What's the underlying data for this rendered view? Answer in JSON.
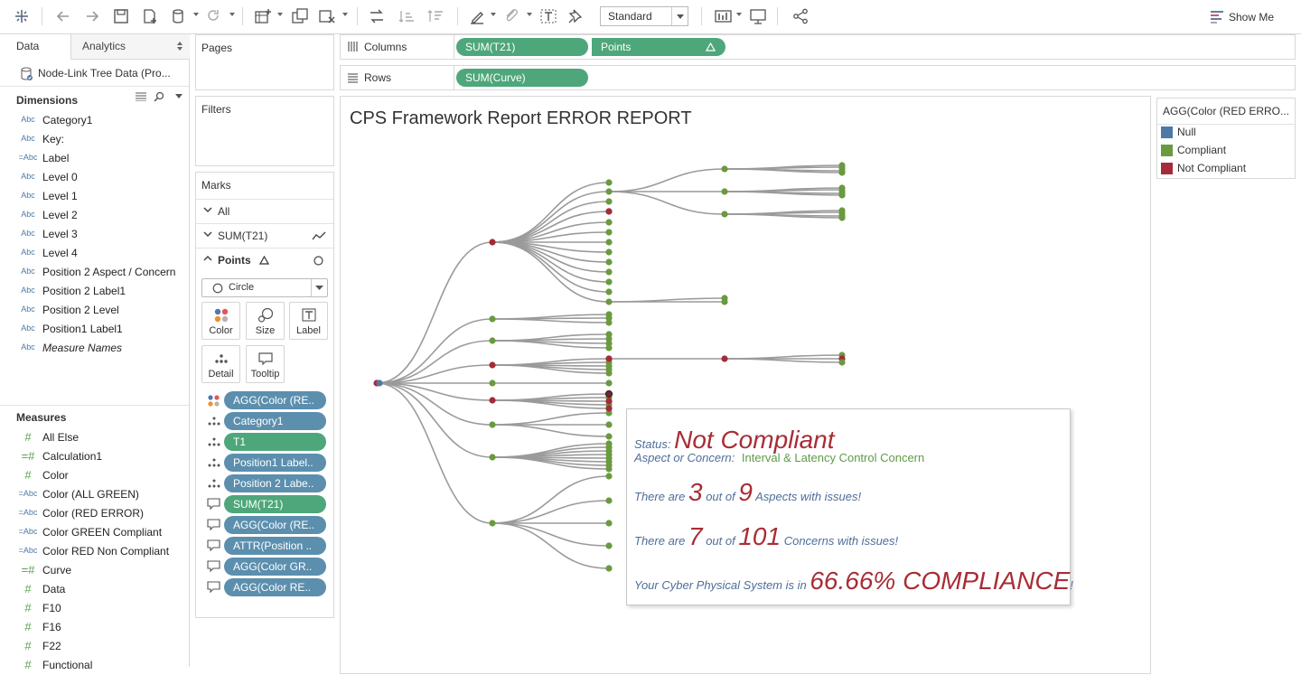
{
  "toolbar": {
    "fit_value": "Standard",
    "show_me_label": "Show Me"
  },
  "data_pane": {
    "tabs": [
      "Data",
      "Analytics"
    ],
    "datasource": "Node-Link Tree Data (Pro...",
    "dimensions_title": "Dimensions",
    "dimensions": [
      {
        "type": "Abc",
        "name": "Category1"
      },
      {
        "type": "Abc",
        "name": "Key:"
      },
      {
        "type": "=Abc",
        "name": "Label"
      },
      {
        "type": "Abc",
        "name": "Level 0"
      },
      {
        "type": "Abc",
        "name": "Level 1"
      },
      {
        "type": "Abc",
        "name": "Level 2"
      },
      {
        "type": "Abc",
        "name": "Level 3"
      },
      {
        "type": "Abc",
        "name": "Level 4"
      },
      {
        "type": "Abc",
        "name": "Position 2 Aspect / Concern"
      },
      {
        "type": "Abc",
        "name": "Position 2 Label1"
      },
      {
        "type": "Abc",
        "name": "Position 2 Level"
      },
      {
        "type": "Abc",
        "name": "Position1 Label1"
      },
      {
        "type": "Abc",
        "name": "Measure Names"
      }
    ],
    "measures_title": "Measures",
    "measures": [
      {
        "type": "#",
        "name": "All Else"
      },
      {
        "type": "=#",
        "name": "Calculation1"
      },
      {
        "type": "#",
        "name": "Color"
      },
      {
        "type": "=Abc",
        "name": "Color (ALL GREEN)"
      },
      {
        "type": "=Abc",
        "name": "Color (RED ERROR)"
      },
      {
        "type": "=Abc",
        "name": "Color GREEN  Compliant"
      },
      {
        "type": "=Abc",
        "name": "Color RED Non Compliant"
      },
      {
        "type": "=#",
        "name": "Curve"
      },
      {
        "type": "#",
        "name": "Data"
      },
      {
        "type": "#",
        "name": "F10"
      },
      {
        "type": "#",
        "name": "F16"
      },
      {
        "type": "#",
        "name": "F22"
      },
      {
        "type": "#",
        "name": "Functional"
      }
    ]
  },
  "cards": {
    "pages": "Pages",
    "filters": "Filters",
    "marks": "Marks"
  },
  "shelves": {
    "columns_label": "Columns",
    "rows_label": "Rows",
    "columns": [
      "SUM(T21)",
      "Points"
    ],
    "rows": [
      "SUM(Curve)"
    ]
  },
  "marks": {
    "rows": [
      "All",
      "SUM(T21)",
      "Points"
    ],
    "mark_type": "Circle",
    "buttons": [
      "Color",
      "Size",
      "Label",
      "Detail",
      "Tooltip"
    ],
    "pills": [
      {
        "icon": "color",
        "label": "AGG(Color (RE..",
        "color": "blue"
      },
      {
        "icon": "detail",
        "label": "Category1",
        "color": "blue"
      },
      {
        "icon": "detail",
        "label": "T1",
        "color": "green"
      },
      {
        "icon": "detail",
        "label": "Position1 Label..",
        "color": "blue"
      },
      {
        "icon": "detail",
        "label": "Position 2 Labe..",
        "color": "blue"
      },
      {
        "icon": "tooltip",
        "label": "SUM(T21)",
        "color": "green"
      },
      {
        "icon": "tooltip",
        "label": "AGG(Color (RE..",
        "color": "blue"
      },
      {
        "icon": "tooltip",
        "label": "ATTR(Position ..",
        "color": "blue"
      },
      {
        "icon": "tooltip",
        "label": "AGG(Color GR..",
        "color": "blue"
      },
      {
        "icon": "tooltip",
        "label": "AGG(Color RE..",
        "color": "blue"
      }
    ]
  },
  "viz": {
    "title": "CPS Framework Report ERROR REPORT",
    "colors": {
      "null": "#4e79a7",
      "compliant": "#6a9a3f",
      "not_compliant": "#a52a3a",
      "link": "#9a9a9a"
    }
  },
  "tooltip": {
    "status_label": "Status:",
    "status_value": "Not Compliant",
    "aspect_label": "Aspect or Concern:",
    "aspect_value": "Interval & Latency Control Concern",
    "aspects_prefix": "There are",
    "aspects_issues": "3",
    "aspects_out_of": "out of",
    "aspects_total": "9",
    "aspects_suffix": "Aspects with issues!",
    "concerns_prefix": "There are",
    "concerns_issues": "7",
    "concerns_out_of": "out of",
    "concerns_total": "101",
    "concerns_suffix": "Concerns with issues!",
    "compliance_prefix": "Your Cyber Physical System is in",
    "compliance_value": "66.66% COMPLIANCE",
    "compliance_suffix": "!"
  },
  "legend": {
    "title": "AGG(Color (RED ERRO...",
    "items": [
      {
        "label": "Null",
        "color": "#4e79a7"
      },
      {
        "label": "Compliant",
        "color": "#6a9a3f"
      },
      {
        "label": "Not Compliant",
        "color": "#a52a3a"
      }
    ]
  }
}
